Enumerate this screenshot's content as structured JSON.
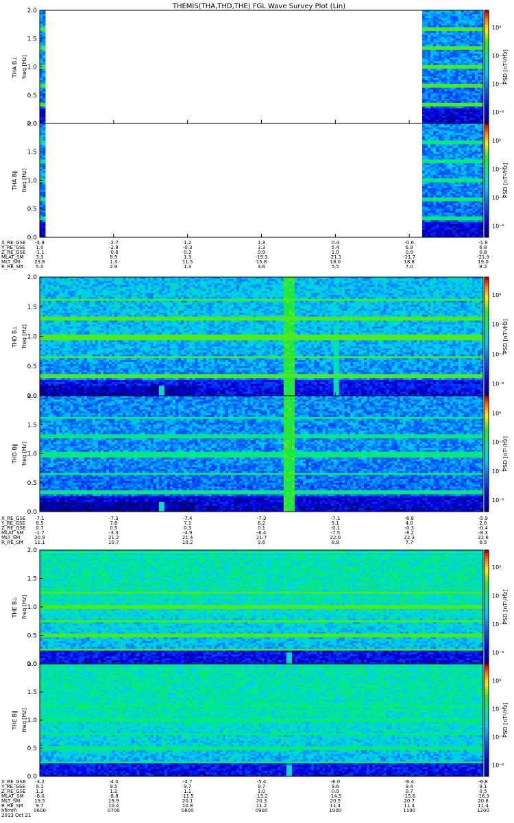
{
  "title": "THEMIS(THA,THD,THE) FGL Wave Survey Plot (Lin)",
  "ylabel_freq": "freq [Hz]",
  "colorbar_label": "PSD [nT²/Hz]",
  "colorbar_ticks": [
    "10⁰",
    "10⁻²",
    "10⁻⁴",
    "10⁻⁶"
  ],
  "colors": {
    "spectrogram_colormap": "rainbow (dark blue → blue → cyan → green → yellow → red)"
  },
  "chart_data": {
    "type": "heatmap",
    "x_range_hhmm": [
      "0600",
      "1200"
    ],
    "freq_range_hz": [
      0.0,
      2.0
    ],
    "yticks": [
      "0.0",
      "0.5",
      "1.0",
      "1.5",
      "2.0"
    ],
    "panels": [
      {
        "label": "THA B⊥",
        "has_data_from": "1110",
        "also_data_at": "0600"
      },
      {
        "label": "THA B∥",
        "has_data_from": "1110",
        "also_data_at": "0600"
      },
      {
        "label": "THD B⊥"
      },
      {
        "label": "THD B∥"
      },
      {
        "label": "THE B⊥"
      },
      {
        "label": "THE B∥"
      }
    ],
    "ephemeris": [
      {
        "rows": [
          {
            "label": "X_RE_GSE",
            "values": [
              "-4.8",
              "-2.7",
              "1.2",
              "1.3",
              "0.4",
              "-0.6",
              "-1.8"
            ]
          },
          {
            "label": "Y_RE_GSE",
            "values": [
              "1.0",
              "-2.8",
              "-0.3",
              "3.3",
              "5.4",
              "6.9",
              "6.8"
            ]
          },
          {
            "label": "Z_RE_GSE",
            "values": [
              "-1.1",
              "-0.8",
              "0.3",
              "0.9",
              "1.0",
              "0.9",
              "0.8"
            ]
          },
          {
            "label": "MLAT_SM",
            "values": [
              "3.3",
              "8.9",
              "1.3",
              "-19.3",
              "-21.1",
              "-21.7",
              "-21.9"
            ]
          },
          {
            "label": "MLT_SM",
            "values": [
              "23.8",
              "1.3",
              "11.5",
              "15.8",
              "18.0",
              "18.8",
              "19.0"
            ]
          },
          {
            "label": "R_RE_SM",
            "values": [
              "5.0",
              "2.9",
              "1.3",
              "3.6",
              "5.5",
              "7.0",
              "8.2"
            ]
          }
        ]
      },
      {
        "rows": [
          {
            "label": "X_RE_GSE",
            "values": [
              "-7.1",
              "-7.3",
              "-7.4",
              "-7.3",
              "-7.1",
              "-6.8",
              "-5.9"
            ]
          },
          {
            "label": "Y_RE_GSE",
            "values": [
              "8.5",
              "7.8",
              "7.1",
              "6.2",
              "5.1",
              "4.0",
              "2.6"
            ]
          },
          {
            "label": "Z_RE_GSE",
            "values": [
              "0.7",
              "0.5",
              "0.3",
              "0.1",
              "-0.1",
              "-0.3",
              "-0.4"
            ]
          },
          {
            "label": "MLAT_SM",
            "values": [
              "-1.7",
              "-3.3",
              "-4.9",
              "-6.4",
              "-7.5",
              "-8.2",
              "-8.3"
            ]
          },
          {
            "label": "MLT_SM",
            "values": [
              "20.9",
              "21.2",
              "21.4",
              "21.7",
              "22.0",
              "22.3",
              "22.6"
            ]
          },
          {
            "label": "R_RE_SM",
            "values": [
              "11.1",
              "10.7",
              "10.2",
              "9.6",
              "8.8",
              "7.7",
              "6.5"
            ]
          }
        ]
      },
      {
        "rows": [
          {
            "label": "X_RE_GSE",
            "values": [
              "-3.2",
              "-4.0",
              "-4.7",
              "-5.4",
              "-6.0",
              "-6.4",
              "-6.8"
            ]
          },
          {
            "label": "Y_RE_GSE",
            "values": [
              "9.1",
              "9.5",
              "9.7",
              "9.7",
              "9.6",
              "9.4",
              "9.1"
            ]
          },
          {
            "label": "Z_RE_GSE",
            "values": [
              "1.3",
              "1.2",
              "1.1",
              "1.0",
              "0.9",
              "0.7",
              "0.5"
            ]
          },
          {
            "label": "MLAT_SM",
            "values": [
              "-6.0",
              "-8.8",
              "-11.5",
              "-13.2",
              "-14.5",
              "-15.6",
              "-16.3"
            ]
          },
          {
            "label": "MLT_SM",
            "values": [
              "19.5",
              "19.9",
              "20.1",
              "20.3",
              "20.5",
              "20.7",
              "20.8"
            ]
          },
          {
            "label": "R_RE_SM",
            "values": [
              "9.7",
              "10.4",
              "10.8",
              "11.2",
              "11.4",
              "11.4",
              "11.4"
            ]
          },
          {
            "label": "hhmm",
            "values": [
              "0600",
              "0700",
              "0800",
              "0900",
              "1000",
              "1100",
              "1200"
            ]
          }
        ],
        "date_label": "2013 Oct 21"
      }
    ]
  }
}
